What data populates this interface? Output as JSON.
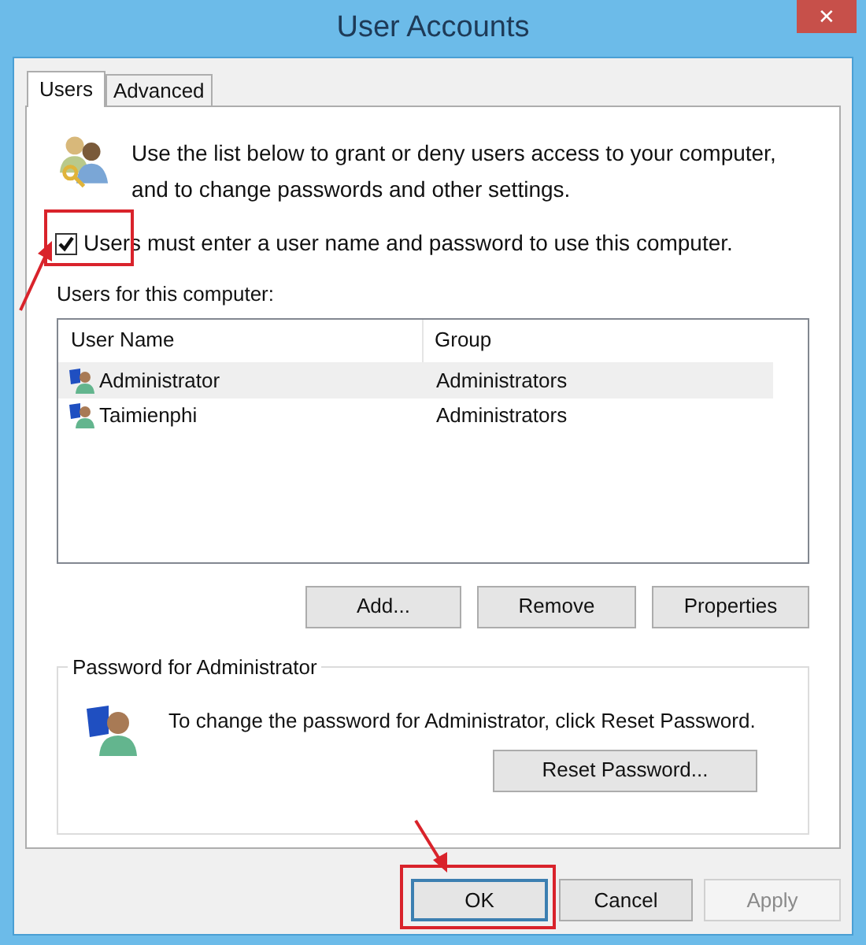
{
  "window": {
    "title": "User Accounts",
    "close": "✕"
  },
  "tabs": [
    {
      "label": "Users",
      "selected": true
    },
    {
      "label": "Advanced",
      "selected": false
    }
  ],
  "intro": "Use the list below to grant or deny users access to your computer, and to change passwords and other settings.",
  "require_login": {
    "label": "Users must enter a user name and password to use this computer.",
    "checked": true
  },
  "users_label": "Users for this computer:",
  "table": {
    "columns": [
      "User Name",
      "Group"
    ],
    "rows": [
      {
        "name": "Administrator",
        "group": "Administrators",
        "selected": true
      },
      {
        "name": "Taimienphi",
        "group": "Administrators",
        "selected": false
      }
    ]
  },
  "list_buttons": [
    "Add...",
    "Remove",
    "Properties"
  ],
  "password_group": {
    "title": "Password for Administrator",
    "text": "To change the password for Administrator, click Reset Password.",
    "button": "Reset Password..."
  },
  "dialog_buttons": [
    {
      "label": "OK",
      "disabled": false,
      "default": true
    },
    {
      "label": "Cancel",
      "disabled": false,
      "default": false
    },
    {
      "label": "Apply",
      "disabled": true,
      "default": false
    }
  ]
}
